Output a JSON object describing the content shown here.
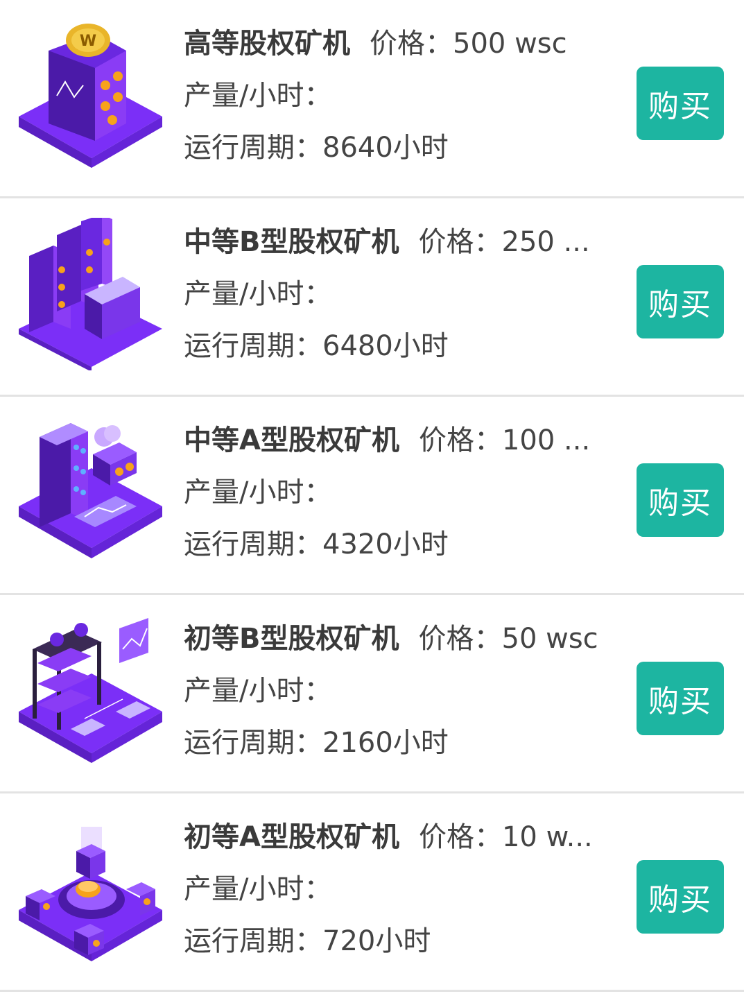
{
  "products": [
    {
      "title": "高等股权矿机",
      "price_label": "价格：",
      "price_value": "500 wsc",
      "output_label": "产量/小时：",
      "period_label": "运行周期：",
      "period_value": "8640小时",
      "buy_label": "购买",
      "icon": "gold-coin-mining-cube-icon"
    },
    {
      "title": "中等B型股权矿机",
      "price_label": "价格：",
      "price_value": "250 ...",
      "output_label": "产量/小时：",
      "period_label": "运行周期：",
      "period_value": "6480小时",
      "buy_label": "购买",
      "icon": "server-racks-icon"
    },
    {
      "title": "中等A型股权矿机",
      "price_label": "价格：",
      "price_value": "100 ...",
      "output_label": "产量/小时：",
      "period_label": "运行周期：",
      "period_value": "4320小时",
      "buy_label": "购买",
      "icon": "data-center-building-icon"
    },
    {
      "title": "初等B型股权矿机",
      "price_label": "价格：",
      "price_value": "50 wsc",
      "output_label": "产量/小时：",
      "period_label": "运行周期：",
      "period_value": "2160小时",
      "buy_label": "购买",
      "icon": "mining-farm-icon"
    },
    {
      "title": "初等A型股权矿机",
      "price_label": "价格：",
      "price_value": "10 w...",
      "output_label": "产量/小时：",
      "period_label": "运行周期：",
      "period_value": "720小时",
      "buy_label": "购买",
      "icon": "bitcoin-reactor-icon"
    }
  ],
  "colors": {
    "button": "#1db5a1",
    "illustration_primary": "#7b2ff7",
    "illustration_dark": "#5a1fc2",
    "illustration_accent": "#f7a21b"
  }
}
